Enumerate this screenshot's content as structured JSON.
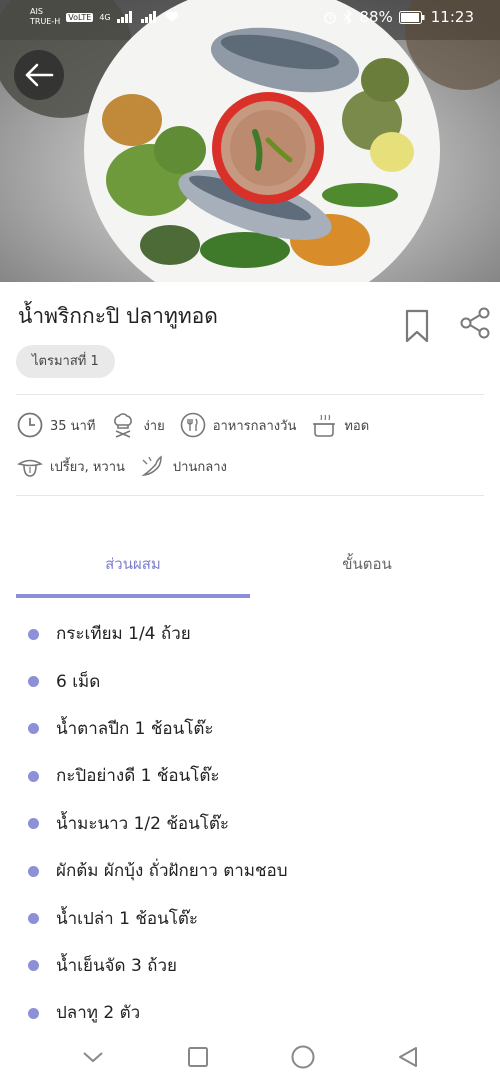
{
  "status_bar": {
    "carrier_top": "AIS",
    "carrier_bottom": "TRUE-H",
    "volte": "VoLTE",
    "network": "4G",
    "battery": "88%",
    "time": "11:23"
  },
  "recipe": {
    "title": "น้ำพริกกะปิ ปลาทูทอด",
    "tag": "ไตรมาสที่ 1",
    "meta": {
      "time": "35 นาที",
      "difficulty": "ง่าย",
      "meal": "อาหารกลางวัน",
      "method": "ทอด",
      "taste": "เปรี้ยว, หวาน",
      "spice": "ปานกลาง"
    }
  },
  "tabs": {
    "ingredients": "ส่วนผสม",
    "steps": "ขั้นตอน"
  },
  "ingredients": [
    "กระเทียม 1/4 ถ้วย",
    "6 เม็ด",
    "น้ำตาลปีก 1 ช้อนโต๊ะ",
    "กะปิอย่างดี 1 ช้อนโต๊ะ",
    "น้ำมะนาว 1/2 ช้อนโต๊ะ",
    "ผักต้ม ผักบุ้ง ถั่วฝักยาว ตามชอบ",
    "น้ำเปล่า 1 ช้อนโต๊ะ",
    "น้ำเย็นจัด 3 ถ้วย",
    "ปลาทู 2 ตัว"
  ],
  "colors": {
    "accent": "#8a8fd8",
    "bullet": "#8d90d6",
    "tag_bg": "#e9e9e9"
  }
}
